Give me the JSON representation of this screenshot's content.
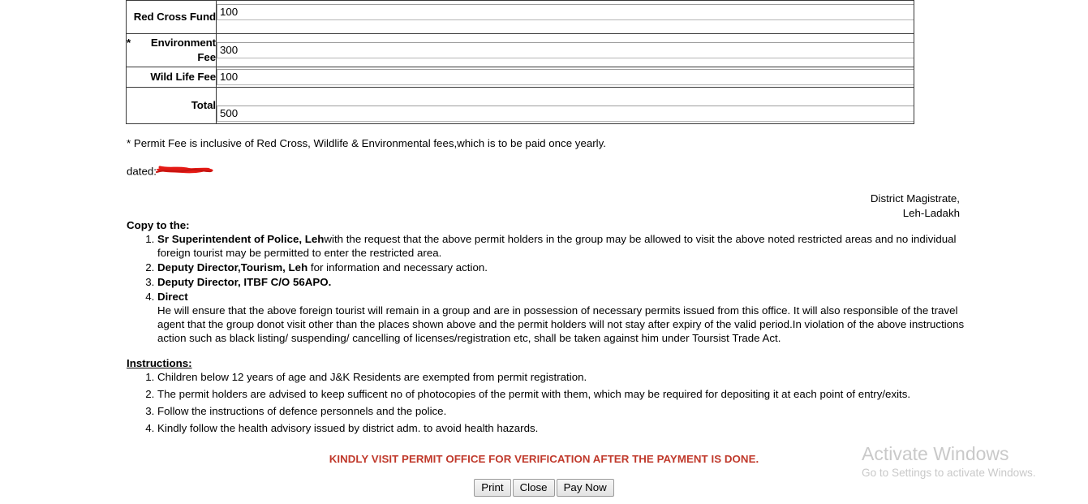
{
  "fee_table": {
    "rows": [
      {
        "label": "Red Cross Fund",
        "star": "",
        "value": "100"
      },
      {
        "label": "Environment Fee",
        "star": "*",
        "value": "300"
      },
      {
        "label": "Wild Life Fee",
        "star": "",
        "value": "100"
      },
      {
        "label": "Total",
        "star": "",
        "value": "500"
      }
    ]
  },
  "note": "* Permit Fee is inclusive of Red Cross, Wildlife & Environmental fees,which is to be paid once yearly.",
  "dated": {
    "label": "dated:",
    "value_redacted": true,
    "redaction_color": "#e41a15"
  },
  "signature": {
    "line1": "District Magistrate,",
    "line2": "Leh-Ladakh"
  },
  "copy_to": {
    "heading": "Copy to the:",
    "items": [
      {
        "bold": "Sr Superintendent of Police, Leh",
        "rest": "with the request that the above permit holders in the group may be allowed to visit the above noted restricted areas and no individual foreign tourist may be permitted to enter the restricted area."
      },
      {
        "bold": "Deputy Director,Tourism, Leh",
        "rest": " for information and necessary action."
      },
      {
        "bold": "Deputy Director, ITBF C/O 56APO.",
        "rest": ""
      },
      {
        "bold": "Direct",
        "rest": "",
        "paragraph": "He will ensure that the above foreign tourist will remain in a group and are in possession of necessary permits issued from this office. It will also responsible of the travel agent that the group donot visit other than the places shown above and the permit holders will not stay after expiry of the valid period.In violation of the above instructions action such as black listing/ suspending/ cancelling of licenses/registration etc, shall be taken against him under Toursist Trade Act."
      }
    ]
  },
  "instructions": {
    "heading": "Instructions:",
    "items": [
      "Children below 12 years of age and J&K Residents are exempted from permit registration.",
      "The permit holders are advised to keep sufficent no of photocopies of the permit with them, which may be required for depositing it at each point of entry/exits.",
      "Follow the instructions of defence personnels and the police.",
      "Kindly follow the health advisory issued by district adm. to avoid health hazards."
    ]
  },
  "red_notice": {
    "text": "KINDLY VISIT PERMIT OFFICE FOR VERIFICATION AFTER THE PAYMENT IS DONE.",
    "color": "#c0392b"
  },
  "buttons": [
    {
      "label": "Print"
    },
    {
      "label": "Close"
    },
    {
      "label": "Pay Now"
    }
  ],
  "watermark": {
    "title": "Activate Windows",
    "subtitle": "Go to Settings to activate Windows."
  }
}
